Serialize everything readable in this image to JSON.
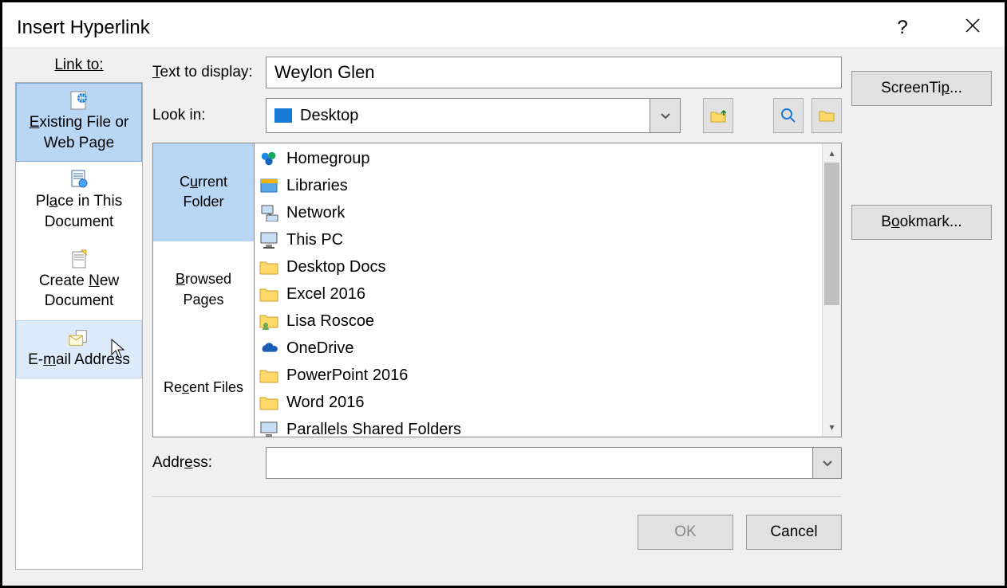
{
  "dialog": {
    "title": "Insert Hyperlink"
  },
  "linkTo": {
    "label": "Link to:",
    "items": [
      {
        "line1": "Existing File or",
        "line2": "Web Page"
      },
      {
        "line1": "Place in This",
        "line2": "Document"
      },
      {
        "line1": "Create New",
        "line2": "Document"
      },
      {
        "line1": "E-mail Address",
        "line2": ""
      }
    ]
  },
  "textToDisplay": {
    "label": "Text to display:",
    "value": "Weylon Glen"
  },
  "lookIn": {
    "label": "Look in:",
    "value": "Desktop"
  },
  "browseTabs": [
    {
      "line1": "Current",
      "line2": "Folder"
    },
    {
      "line1": "Browsed",
      "line2": "Pages"
    },
    {
      "line1": "Recent Files",
      "line2": ""
    }
  ],
  "files": [
    {
      "name": "Homegroup",
      "icon": "homegroup"
    },
    {
      "name": "Libraries",
      "icon": "libraries"
    },
    {
      "name": "Network",
      "icon": "network"
    },
    {
      "name": "This PC",
      "icon": "pc"
    },
    {
      "name": "Desktop Docs",
      "icon": "folder"
    },
    {
      "name": "Excel 2016",
      "icon": "folder"
    },
    {
      "name": "Lisa Roscoe",
      "icon": "user"
    },
    {
      "name": "OneDrive",
      "icon": "onedrive"
    },
    {
      "name": "PowerPoint 2016",
      "icon": "folder"
    },
    {
      "name": "Word 2016",
      "icon": "folder"
    },
    {
      "name": "Parallels Shared Folders",
      "icon": "pc"
    }
  ],
  "address": {
    "label": "Address:",
    "value": ""
  },
  "buttons": {
    "screentip": "ScreenTip...",
    "bookmark": "Bookmark...",
    "ok": "OK",
    "cancel": "Cancel"
  }
}
